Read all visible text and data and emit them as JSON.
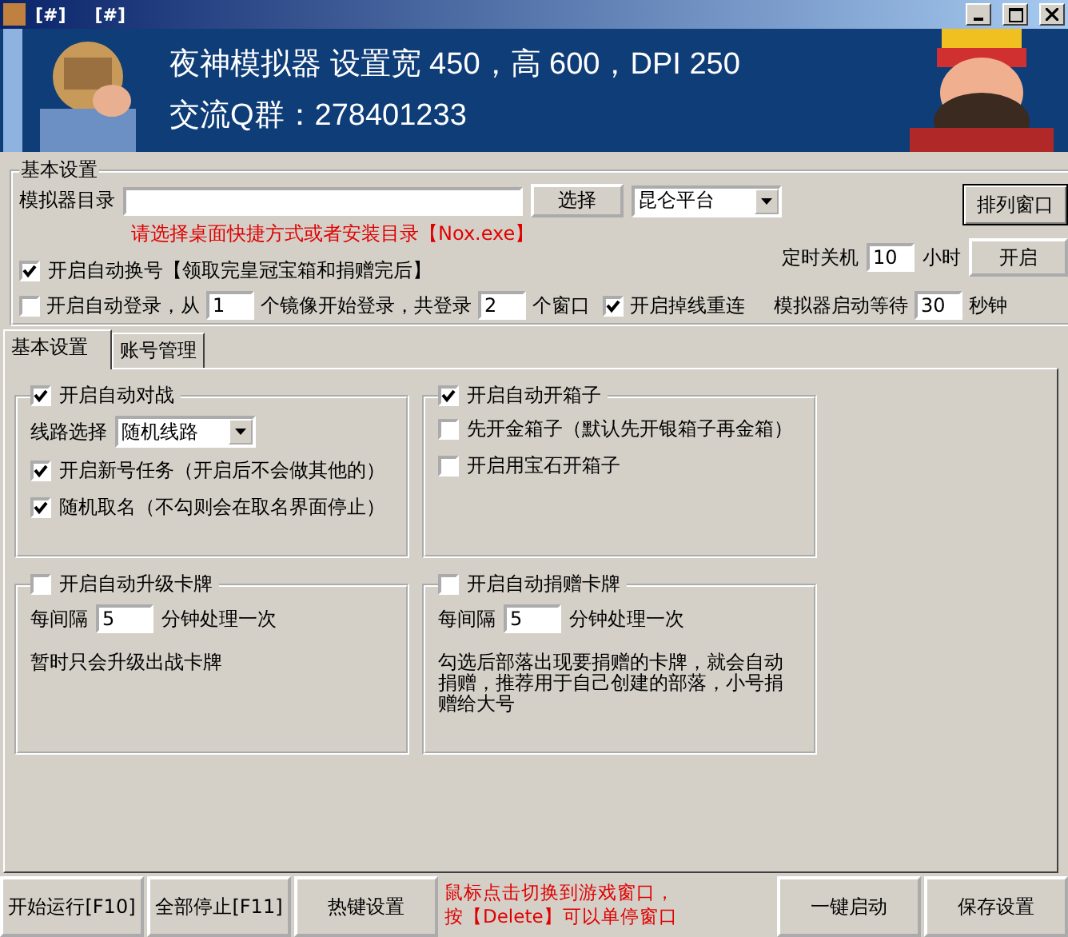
{
  "window": {
    "title_parts": [
      "[#]",
      "[#]"
    ]
  },
  "banner": {
    "line1": "夜神模拟器 设置宽 450，高 600，DPI 250",
    "line2": "交流Q群：278401233"
  },
  "basic_settings": {
    "title": "基本设置",
    "dir_label": "模拟器目录",
    "select_button": "选择",
    "platform": "昆仑平台",
    "arrange_button": "排列窗口",
    "hint": "请选择桌面快捷方式或者安装目录【Nox.exe】",
    "shutdown_label": "定时关机",
    "shutdown_hours": "10",
    "hours_unit": "小时",
    "shutdown_button": "开启",
    "auto_switch": {
      "label": "开启自动换号【领取完皇冠宝箱和捐赠完后】",
      "checked": true
    },
    "auto_login": {
      "label": "开启自动登录，从",
      "checked": false
    },
    "login_from": "1",
    "login_mid": "个镜像开始登录，共登录",
    "login_count": "2",
    "login_unit": "个窗口",
    "reconnect": {
      "label": "开启掉线重连",
      "checked": true
    },
    "wait_label": "模拟器启动等待",
    "wait_value": "30",
    "wait_unit": "秒钟"
  },
  "tabs": [
    {
      "label": "基本设置",
      "selected": true
    },
    {
      "label": "账号管理",
      "selected": false
    }
  ],
  "groups": [
    {
      "title": "开启自动对战",
      "checked": true,
      "items": [
        {
          "kind": "select",
          "label": "线路选择",
          "value": "随机线路"
        },
        {
          "kind": "checkbox",
          "label": "开启新号任务（开启后不会做其他的）",
          "checked": true
        },
        {
          "kind": "checkbox",
          "label": "随机取名（不勾则会在取名界面停止）",
          "checked": true
        }
      ]
    },
    {
      "title": "开启自动开箱子",
      "checked": true,
      "items": [
        {
          "kind": "checkbox",
          "label": "先开金箱子（默认先开银箱子再金箱）",
          "checked": false
        },
        {
          "kind": "checkbox",
          "label": "开启用宝石开箱子",
          "checked": false
        }
      ]
    },
    {
      "title": "开启自动升级卡牌",
      "checked": false,
      "items": [
        {
          "kind": "interval",
          "label": "每间隔",
          "value": "5",
          "unit": "分钟处理一次"
        },
        {
          "kind": "note",
          "text": "暂时只会升级出战卡牌"
        }
      ]
    },
    {
      "title": "开启自动捐赠卡牌",
      "checked": false,
      "items": [
        {
          "kind": "interval",
          "label": "每间隔",
          "value": "5",
          "unit": "分钟处理一次"
        },
        {
          "kind": "note",
          "text": "勾选后部落出现要捐赠的卡牌，就会自动捐赠，推荐用于自己创建的部落，小号捐赠给大号"
        }
      ]
    }
  ],
  "bottom_bar": [
    {
      "kind": "button",
      "label": "开始运行[F10]"
    },
    {
      "kind": "button",
      "label": "全部停止[F11]"
    },
    {
      "kind": "button",
      "label": "热键设置"
    },
    {
      "kind": "note",
      "lines": [
        "鼠标点击切换到游戏窗口，",
        "按【Delete】可以单停窗口"
      ]
    },
    {
      "kind": "button",
      "label": "一键启动"
    },
    {
      "kind": "button",
      "label": "保存设置"
    }
  ]
}
